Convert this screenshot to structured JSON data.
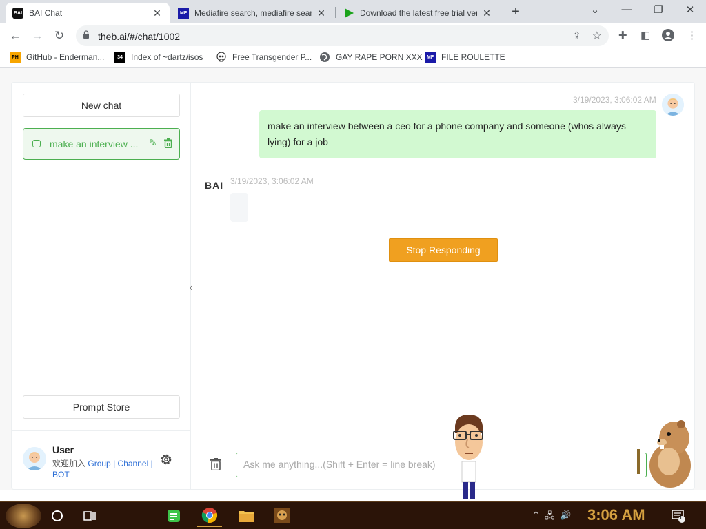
{
  "browser": {
    "tabs": [
      {
        "title": "BAI Chat",
        "favicon": "BAI",
        "active": true
      },
      {
        "title": "Mediafire search, mediafire search",
        "favicon": "MF"
      },
      {
        "title": "Download the latest free trial ver",
        "favicon": "play-icon"
      }
    ],
    "url": "theb.ai/#/chat/1002",
    "bookmarks": [
      {
        "label": "GitHub - Enderman...",
        "favicon": "PH"
      },
      {
        "label": "Index of ~dartz/isos",
        "favicon": "34"
      },
      {
        "label": "Free Transgender P...",
        "favicon": "skull-icon"
      },
      {
        "label": "GAY RAPE PORN XXX",
        "favicon": "globe-icon"
      },
      {
        "label": "FILE ROULETTE",
        "favicon": "MF"
      }
    ]
  },
  "sidebar": {
    "new_chat_label": "New chat",
    "chats": [
      {
        "title": "make an interview ...",
        "active": true
      }
    ],
    "prompt_store_label": "Prompt Store",
    "user": {
      "name": "User",
      "join_text": "欢迎加入",
      "links": [
        "Group",
        "Channel",
        "BOT"
      ],
      "separator": "|"
    }
  },
  "chat": {
    "messages": [
      {
        "role": "user",
        "timestamp": "3/19/2023, 3:06:02 AM",
        "text": "make an interview between a ceo for a phone company and someone (whos always lying) for a job"
      },
      {
        "role": "bot",
        "sender_label": "BAI",
        "timestamp": "3/19/2023, 3:06:02 AM",
        "text": ""
      }
    ],
    "stop_button_label": "Stop Responding",
    "input": {
      "placeholder": "Ask me anything...(Shift + Enter = line break)",
      "value": ""
    }
  },
  "taskbar": {
    "clock": "3:06 AM",
    "notification_count": "1"
  },
  "colors": {
    "accent_green": "#4caf50",
    "user_bubble": "#d2f9d1",
    "stop_button": "#f0a020",
    "link_blue": "#2d6fd6"
  }
}
